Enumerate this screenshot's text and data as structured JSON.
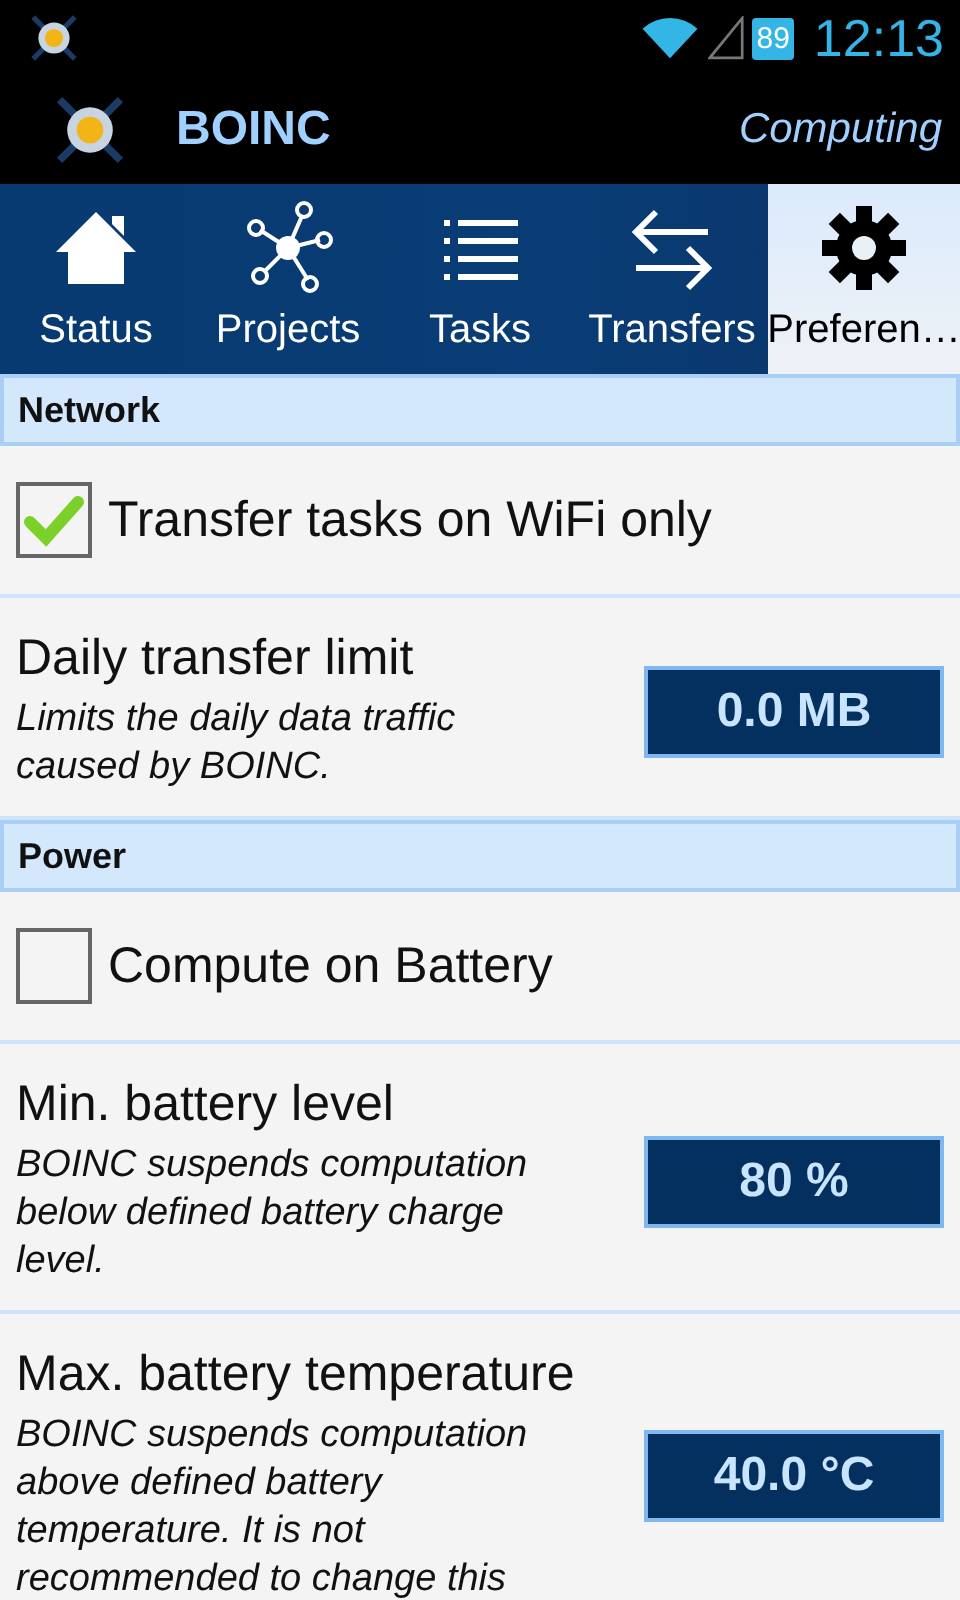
{
  "status_bar": {
    "battery": "89",
    "time": "12:13"
  },
  "app_bar": {
    "title": "BOINC",
    "status": "Computing"
  },
  "tabs": [
    {
      "label": "Status",
      "kind": "home",
      "selected": false
    },
    {
      "label": "Projects",
      "kind": "projects",
      "selected": false
    },
    {
      "label": "Tasks",
      "kind": "tasks",
      "selected": false
    },
    {
      "label": "Transfers",
      "kind": "transfers",
      "selected": false
    },
    {
      "label": "Preferen…",
      "kind": "gear",
      "selected": true
    }
  ],
  "sections": [
    {
      "title": "Network",
      "items": [
        {
          "kind": "checkbox",
          "label": "Transfer tasks on WiFi only",
          "checked": true
        },
        {
          "kind": "value",
          "title": "Daily transfer limit",
          "description": "Limits the daily data traffic caused by BOINC.",
          "value": "0.0 MB"
        }
      ]
    },
    {
      "title": "Power",
      "items": [
        {
          "kind": "checkbox",
          "label": "Compute on Battery",
          "checked": false
        },
        {
          "kind": "value",
          "title": "Min. battery level",
          "description": "BOINC suspends computation below defined battery charge level.",
          "value": "80 %"
        },
        {
          "kind": "value",
          "title": "Max. battery temperature",
          "description": "BOINC suspends computation above defined battery temperature. It is not recommended to change this",
          "value": "40.0 °C"
        }
      ]
    }
  ]
}
